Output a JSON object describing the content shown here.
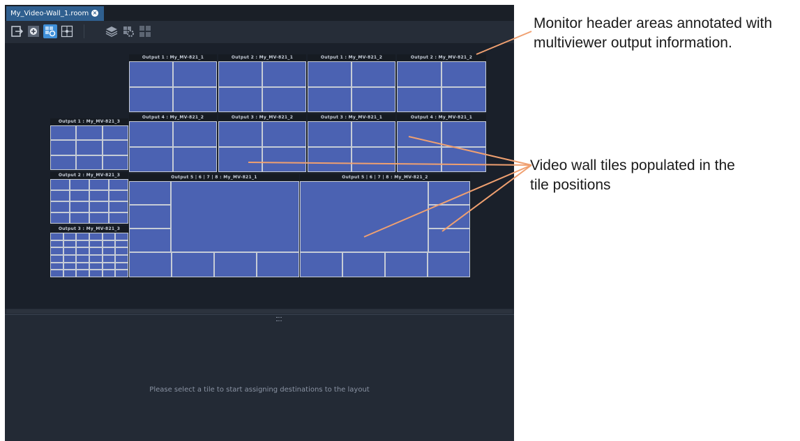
{
  "tab": {
    "title": "My_Video-Wall_1.room",
    "close_icon": "close-circle-icon"
  },
  "toolbar": {
    "buttons": [
      {
        "name": "exit-icon",
        "active": false
      },
      {
        "name": "add-icon",
        "active": false
      },
      {
        "name": "tile-layout-icon",
        "active": true
      },
      {
        "name": "grid-icon",
        "active": false
      },
      {
        "name": "layers-icon",
        "active": false
      },
      {
        "name": "settings-icon",
        "active": false
      },
      {
        "name": "tiles-icon",
        "active": false
      }
    ]
  },
  "monitors": [
    {
      "label": "Output 1 : My_MV-821_1"
    },
    {
      "label": "Output 2 : My_MV-821_1"
    },
    {
      "label": "Output 1 : My_MV-821_2"
    },
    {
      "label": "Output 2 : My_MV-821_2"
    },
    {
      "label": "Output 4 : My_MV-821_2"
    },
    {
      "label": "Output 3 : My_MV-821_2"
    },
    {
      "label": "Output 3 : My_MV-821_1"
    },
    {
      "label": "Output 4 : My_MV-821_1"
    },
    {
      "label": "Output 1 : My_MV-821_3"
    },
    {
      "label": "Output 2 : My_MV-821_3"
    },
    {
      "label": "Output 3 : My_MV-821_3"
    },
    {
      "label": "Output 5 | 6 | 7 | 8 : My_MV-821_1"
    },
    {
      "label": "Output 5 | 6 | 7 | 8 : My_MV-821_2"
    }
  ],
  "bottom_panel": {
    "hint": "Please select a tile to start assigning destinations to the layout"
  },
  "annotations": {
    "header": "Monitor header areas annotated with multiviewer output information.",
    "tiles": "Video wall tiles populated in the tile positions"
  },
  "colors": {
    "tile": "#4b62b2",
    "accent": "#3f8fd8",
    "annotation_line": "#f0a070"
  }
}
